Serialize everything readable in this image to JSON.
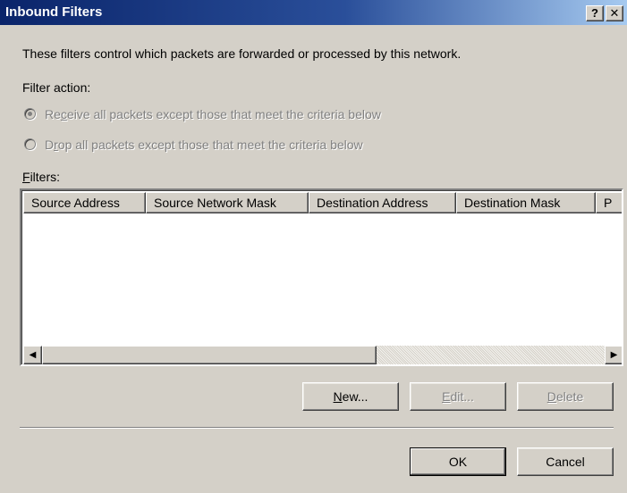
{
  "window": {
    "title": "Inbound Filters",
    "help_label": "?",
    "close_label": "✕"
  },
  "description": "These filters control which packets are forwarded or processed by this network.",
  "filter_action": {
    "label": "Filter action:",
    "options": [
      {
        "pre": "Re",
        "key": "c",
        "post": "eive all packets except those that meet the criteria below",
        "selected": true,
        "enabled": false
      },
      {
        "pre": "D",
        "key": "r",
        "post": "op all packets except those that meet the criteria below",
        "selected": false,
        "enabled": false
      }
    ]
  },
  "filters": {
    "label_key": "F",
    "label_rest": "ilters:",
    "columns": [
      "Source Address",
      "Source Network Mask",
      "Destination Address",
      "Destination Mask",
      "P"
    ],
    "rows": []
  },
  "scrollbar": {
    "left_arrow": "◀",
    "right_arrow": "▶"
  },
  "buttons": {
    "new": {
      "key": "N",
      "rest": "ew...",
      "enabled": true
    },
    "edit": {
      "key": "E",
      "rest": "dit...",
      "enabled": false
    },
    "delete": {
      "key": "D",
      "rest": "elete",
      "enabled": false
    },
    "ok": "OK",
    "cancel": "Cancel"
  }
}
